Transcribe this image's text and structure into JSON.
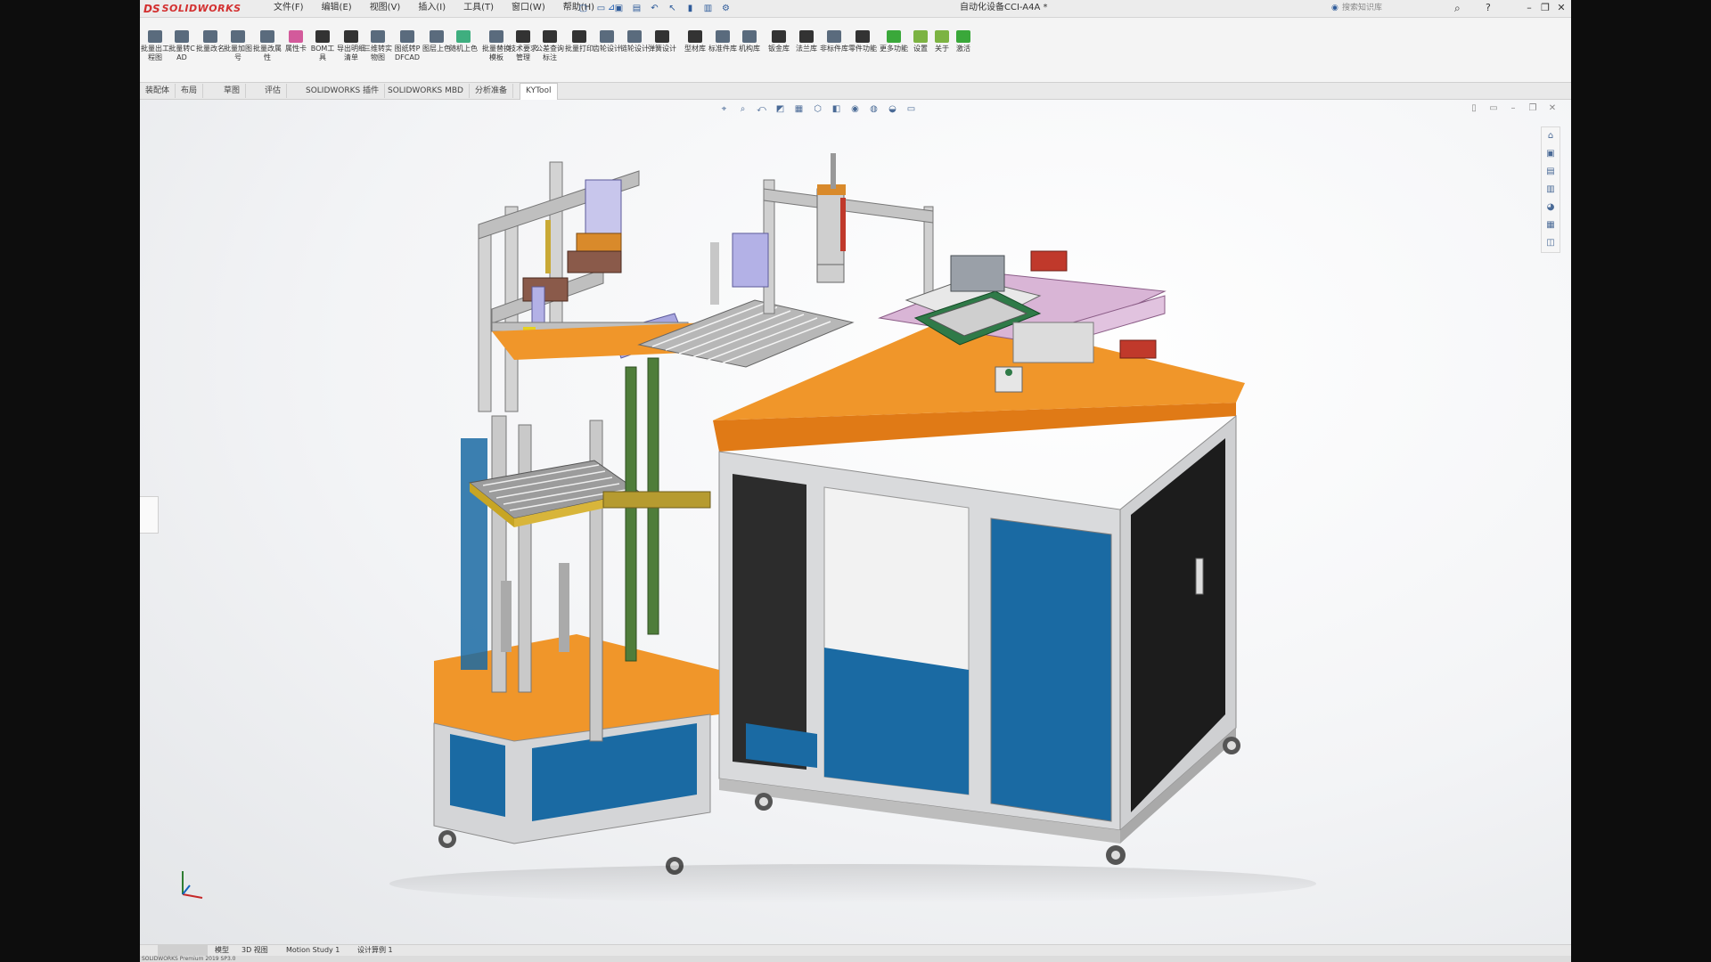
{
  "titlebar": {
    "brand_ds": "DS",
    "brand_sw": "SOLIDWORKS",
    "menus": [
      "文件(F)",
      "编辑(E)",
      "视图(V)",
      "插入(I)",
      "工具(T)",
      "窗口(W)",
      "帮助(H)"
    ],
    "pin_icon": "pin-icon",
    "quick_icons": [
      "new-document-icon",
      "open-icon",
      "save-icon",
      "print-icon",
      "undo-icon",
      "select-icon",
      "rebuild-icon",
      "file-properties-icon",
      "options-icon"
    ],
    "document_title": "自动化设备CCI-A4A *",
    "search_placeholder": "搜索知识库"
  },
  "ribbon": {
    "buttons": [
      {
        "label": "批量出工程图",
        "color": "#5a6b7d",
        "icon": "drawing-icon"
      },
      {
        "label": "批量转CAD",
        "color": "#5a6b7d",
        "icon": "cad-icon"
      },
      {
        "label": "批量改名",
        "color": "#5a6b7d",
        "icon": "rename-icon"
      },
      {
        "label": "批量加图号",
        "color": "#5a6b7d",
        "icon": "number-icon"
      },
      {
        "label": "批量改属性",
        "color": "#5a6b7d",
        "icon": "properties-icon"
      },
      {
        "label": "属性卡",
        "color": "#d35a9b",
        "icon": "property-card-icon"
      },
      {
        "label": "BOM工具",
        "color": "#333333",
        "icon": "bom-icon"
      },
      {
        "label": "导出明细清单",
        "color": "#333333",
        "icon": "export-list-icon"
      },
      {
        "label": "三维转实物图",
        "color": "#5a6b7d",
        "icon": "3d-icon"
      },
      {
        "label": "图纸转PDFCAD",
        "color": "#5a6b7d",
        "icon": "pdf-icon"
      },
      {
        "label": "图层上色",
        "color": "#5a6b7d",
        "icon": "layer-color-icon"
      },
      {
        "label": "随机上色",
        "color": "#3fae7f",
        "icon": "random-color-icon"
      },
      {
        "label": "批量替换模板",
        "color": "#5a6b7d",
        "icon": "template-icon"
      },
      {
        "label": "技术要求管理",
        "color": "#333333",
        "icon": "requirements-icon"
      },
      {
        "label": "公差查询标注",
        "color": "#333333",
        "icon": "tolerance-icon"
      },
      {
        "label": "批量打印",
        "color": "#333333",
        "icon": "print-batch-icon"
      },
      {
        "label": "齿轮设计",
        "color": "#5a6b7d",
        "icon": "gear-icon"
      },
      {
        "label": "链轮设计",
        "color": "#5a6b7d",
        "icon": "sprocket-icon"
      },
      {
        "label": "弹簧设计",
        "color": "#333333",
        "icon": "spring-icon"
      },
      {
        "label": "型材库",
        "color": "#333333",
        "icon": "profile-icon"
      },
      {
        "label": "标准件库",
        "color": "#5a6b7d",
        "icon": "standard-part-icon"
      },
      {
        "label": "机构库",
        "color": "#5a6b7d",
        "icon": "mechanism-icon"
      },
      {
        "label": "钣金库",
        "color": "#333333",
        "icon": "sheetmetal-icon"
      },
      {
        "label": "法兰库",
        "color": "#333333",
        "icon": "flange-icon"
      },
      {
        "label": "非标件库",
        "color": "#5a6b7d",
        "icon": "custom-part-icon"
      },
      {
        "label": "零件功能",
        "color": "#333333",
        "icon": "part-function-icon"
      },
      {
        "label": "更多功能",
        "color": "#3aa83a",
        "icon": "more-icon"
      },
      {
        "label": "设置",
        "color": "#7cb342",
        "icon": "settings-icon"
      },
      {
        "label": "关于",
        "color": "#7cb342",
        "icon": "about-icon"
      },
      {
        "label": "激活",
        "color": "#3aa83a",
        "icon": "activate-icon"
      }
    ]
  },
  "tabs": [
    "装配体",
    "布局",
    "草图",
    "评估",
    "SOLIDWORKS 插件",
    "SOLIDWORKS MBD",
    "分析准备",
    "KYTool"
  ],
  "active_tab": "KYTool",
  "heads_up_toolbar": [
    "zoom-to-fit-icon",
    "zoom-area-icon",
    "previous-view-icon",
    "section-view-icon",
    "dynamic-annotation-icon",
    "view-orientation-icon",
    "display-style-icon",
    "hide-show-icon",
    "edit-appearance-icon",
    "apply-scene-icon",
    "view-settings-icon"
  ],
  "task_pane": [
    "home-icon",
    "resources-icon",
    "design-library-icon",
    "file-explorer-icon",
    "appearances-icon",
    "custom-properties-icon",
    "forum-icon"
  ],
  "bottom_tabs": [
    "模型",
    "3D 视图",
    "Motion Study 1",
    "设计算例 1"
  ],
  "status_text": "SOLIDWORKS Premium 2019 SP3.0"
}
